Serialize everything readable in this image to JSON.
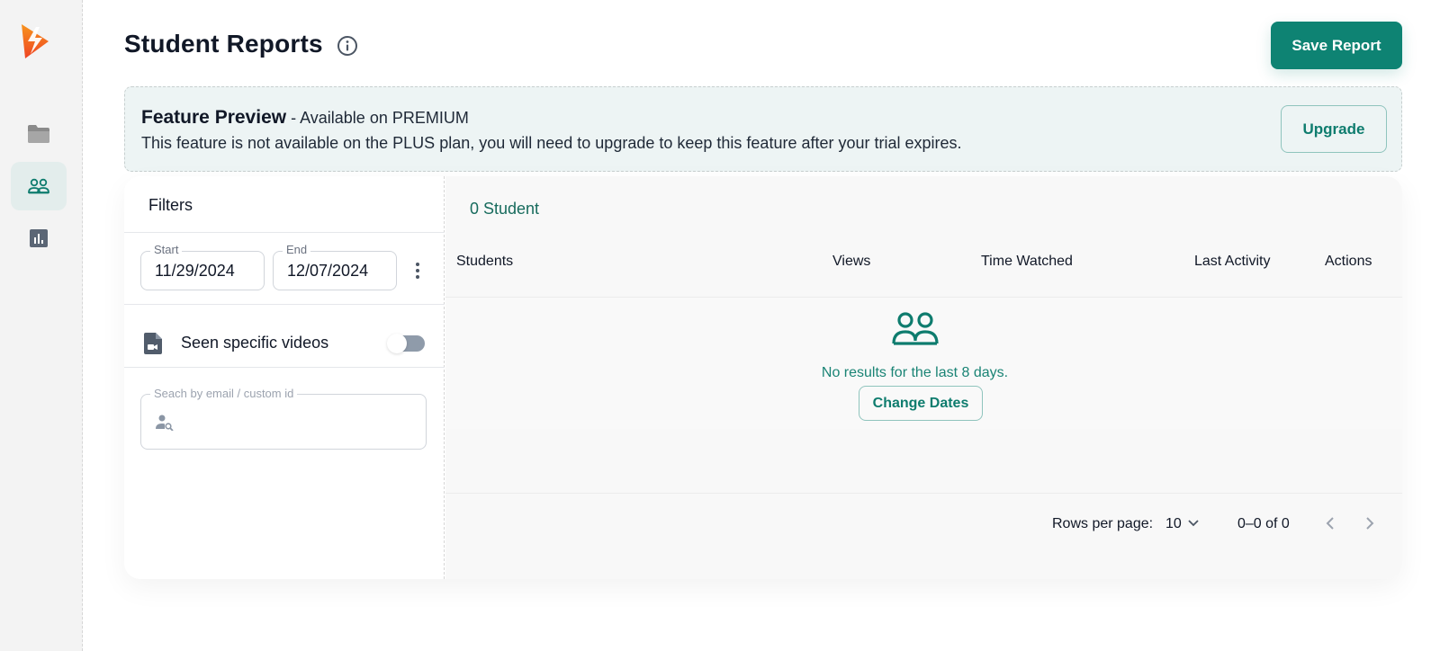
{
  "app": {
    "brand_color": "#f05a22",
    "accent_color": "#0e8373"
  },
  "sidebar": {
    "items": [
      {
        "name": "folder",
        "icon": "folder-icon",
        "active": false
      },
      {
        "name": "students",
        "icon": "users-icon",
        "active": true
      },
      {
        "name": "reports",
        "icon": "bar-chart-icon",
        "active": false
      }
    ]
  },
  "header": {
    "title": "Student Reports",
    "info_icon": "info-icon",
    "save_label": "Save Report"
  },
  "banner": {
    "title": "Feature Preview",
    "subtitle": " - Available on PREMIUM",
    "text": "This feature is not available on the PLUS plan, you will need to upgrade to keep this feature after your trial expires.",
    "upgrade_label": "Upgrade"
  },
  "filters": {
    "title": "Filters",
    "start_label": "Start",
    "start_value": "11/29/2024",
    "end_label": "End",
    "end_value": "12/07/2024",
    "video_filter_label": "Seen specific videos",
    "video_filter_enabled": false,
    "search_label": "Seach by email / custom id",
    "search_value": ""
  },
  "results": {
    "count_label": "0 Student",
    "columns": [
      "Students",
      "Views",
      "Time Watched",
      "Last Activity",
      "Actions"
    ],
    "rows": [],
    "empty_text": "No results for the last 8 days.",
    "change_dates_label": "Change Dates"
  },
  "pagination": {
    "rows_per_page_label": "Rows per page:",
    "rows_per_page_value": "10",
    "range_text": "0–0 of 0"
  }
}
